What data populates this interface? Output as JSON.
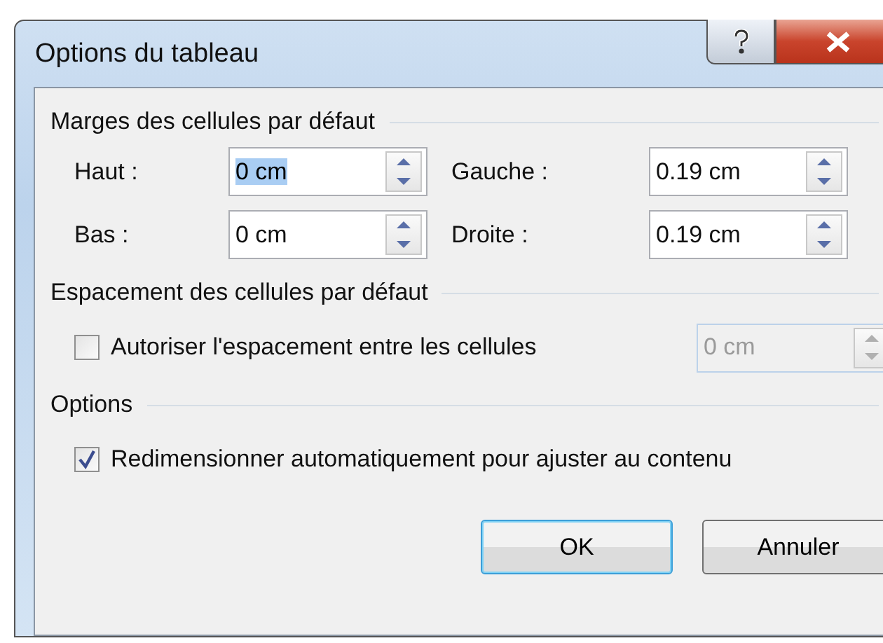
{
  "window": {
    "title": "Options du tableau"
  },
  "sections": [
    {
      "kind": "margins",
      "title": "Marges des cellules par défaut",
      "fields": [
        {
          "label": "Haut :",
          "value": "0 cm",
          "text_selected": true
        },
        {
          "label": "Gauche :",
          "value": "0.19 cm",
          "text_selected": false
        },
        {
          "label": "Bas :",
          "value": "0 cm",
          "text_selected": false
        },
        {
          "label": "Droite :",
          "value": "0.19 cm",
          "text_selected": false
        }
      ]
    },
    {
      "kind": "checkbox_field",
      "title": "Espacement des cellules par défaut",
      "checkbox": {
        "label": "Autoriser l'espacement entre les cellules",
        "checked": false
      },
      "field": {
        "value": "0 cm",
        "disabled": true
      }
    },
    {
      "kind": "checkbox",
      "title": "Options",
      "checkbox": {
        "label": "Redimensionner automatiquement pour ajuster au contenu",
        "checked": true
      }
    }
  ],
  "buttons": [
    {
      "label": "OK",
      "default": true
    },
    {
      "label": "Annuler",
      "default": false
    }
  ]
}
